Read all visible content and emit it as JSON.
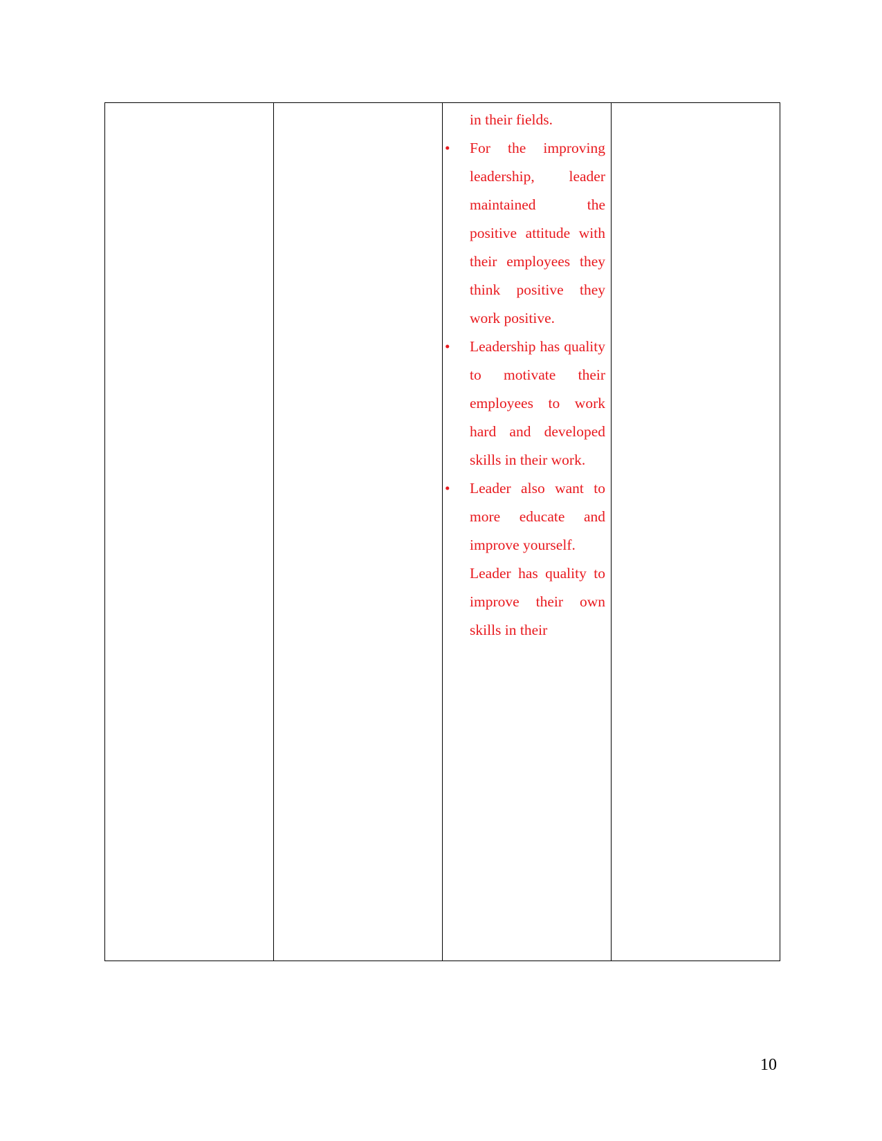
{
  "page": {
    "number": "10",
    "text_color": "#e8191e",
    "border_color": "#000000",
    "background": "#ffffff"
  },
  "table": {
    "columns": 4,
    "cells": {
      "col_a": "",
      "col_b": "",
      "col_d": "",
      "col_c": {
        "continuation_line": "in their fields.",
        "bullet_glyph": "•",
        "items": [
          {
            "bullet": "•",
            "text": "For the improving leadership, leader maintained the positive attitude with their employees they think positive they work positive."
          },
          {
            "bullet": "•",
            "text": "Leadership has quality to motivate their employees to work hard and developed skills in their work."
          },
          {
            "bullet": "•",
            "text": "Leader also want to more educate and improve yourself."
          }
        ],
        "trailing_paragraph": "Leader has quality to improve their own skills in their"
      }
    }
  }
}
